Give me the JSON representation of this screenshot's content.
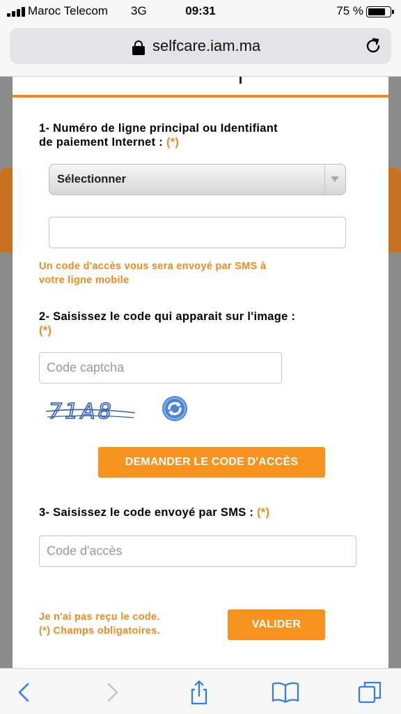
{
  "status": {
    "carrier": "Maroc Telecom",
    "network": "3G",
    "time": "09:31",
    "battery_pct": "75 %"
  },
  "browser": {
    "url": "selfcare.iam.ma"
  },
  "form": {
    "section1_label_line1": "1- Numéro de ligne principal ou Identifiant",
    "section1_label_line2": "de paiement Internet :",
    "required_marker": "(*)",
    "select_value": "Sélectionner",
    "line_input_value": "",
    "sms_note_line1": "Un code d'accès vous sera envoyé par SMS à",
    "sms_note_line2": "votre ligne mobile",
    "section2_label_line1": "2- Saisissez le code qui apparait sur l'image :",
    "captcha_placeholder": "Code captcha",
    "captcha_text": "71A8",
    "request_button": "DEMANDER LE CODE D'ACCÈS",
    "section3_label": "3- Saisissez le code envoyé par SMS :",
    "access_code_placeholder": "Code d'accès",
    "not_received_link": "Je n'ai pas reçu le code.",
    "required_fields_note": "(*) Champs obligatoires.",
    "submit_button": "VALIDER"
  },
  "colors": {
    "accent": "#f7931e",
    "label_orange": "#f28a1e",
    "ios_blue": "#2f7cf6"
  },
  "toolbar": {
    "icons": [
      "back-icon",
      "forward-icon",
      "share-icon",
      "bookmarks-icon",
      "tabs-icon"
    ]
  }
}
